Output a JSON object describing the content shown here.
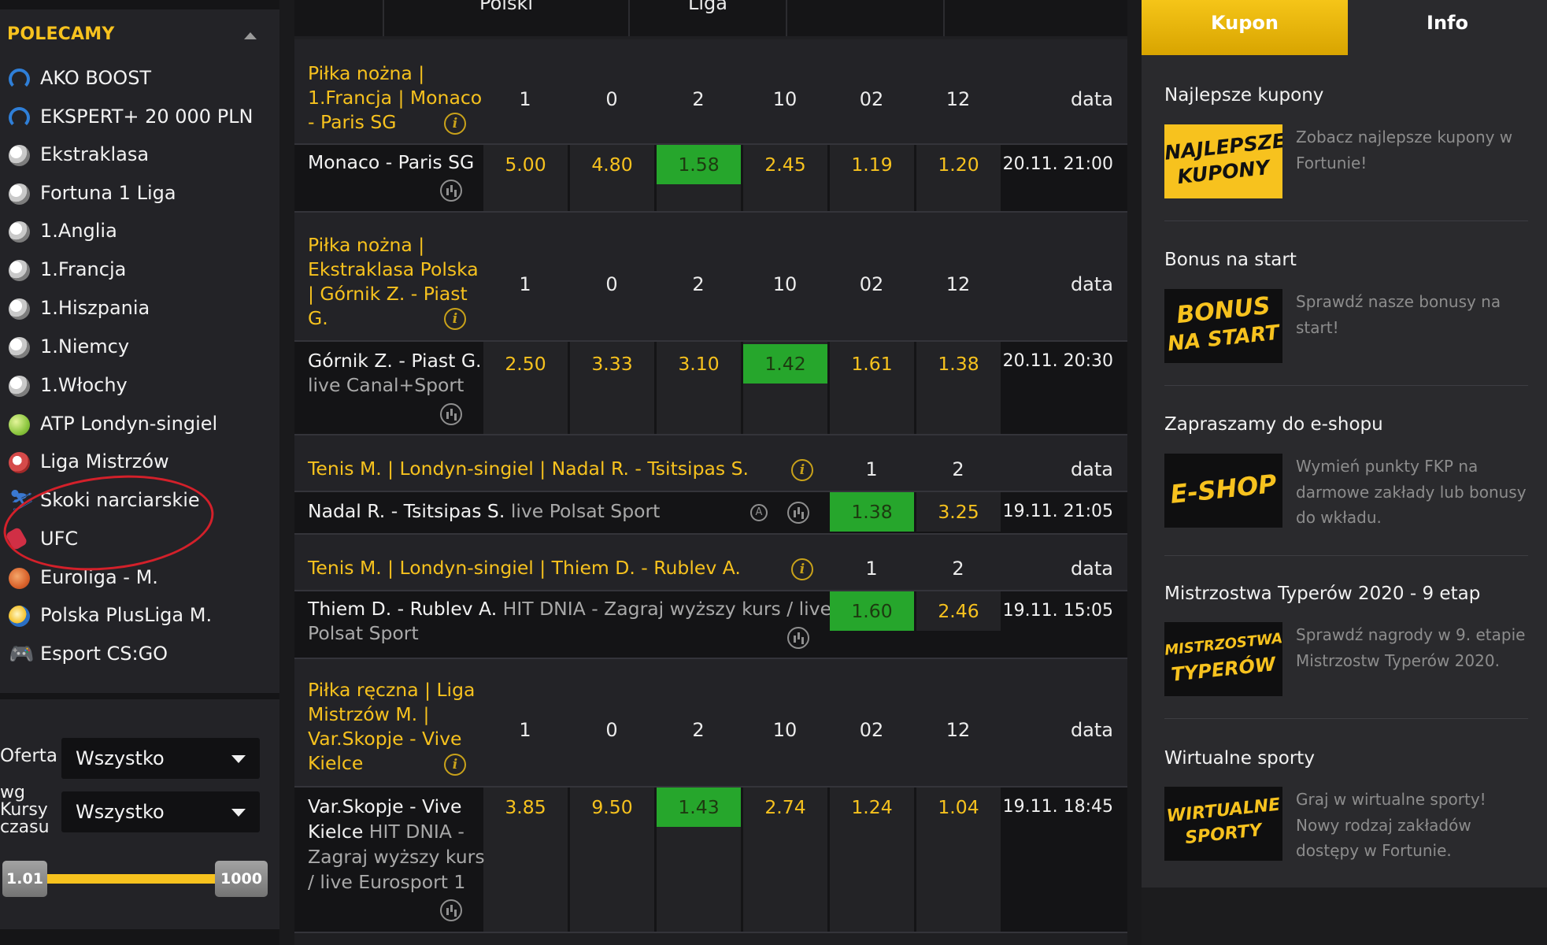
{
  "sidebar": {
    "header": "POLECAMY",
    "items": [
      {
        "label": "AKO BOOST",
        "icon": "headset-icon"
      },
      {
        "label": "EKSPERT+ 20 000 PLN",
        "icon": "headset-icon"
      },
      {
        "label": "Ekstraklasa",
        "icon": "soccer-ball-icon"
      },
      {
        "label": "Fortuna 1 Liga",
        "icon": "soccer-ball-icon"
      },
      {
        "label": "1.Anglia",
        "icon": "soccer-ball-icon"
      },
      {
        "label": "1.Francja",
        "icon": "soccer-ball-icon"
      },
      {
        "label": "1.Hiszpania",
        "icon": "soccer-ball-icon"
      },
      {
        "label": "1.Niemcy",
        "icon": "soccer-ball-icon"
      },
      {
        "label": "1.Włochy",
        "icon": "soccer-ball-icon"
      },
      {
        "label": "ATP Londyn-singiel",
        "icon": "tennis-ball-icon"
      },
      {
        "label": "Liga Mistrzów",
        "icon": "champions-league-ball-icon"
      },
      {
        "label": "Skoki narciarskie",
        "icon": "ski-jumper-icon"
      },
      {
        "label": "UFC",
        "icon": "boxing-glove-icon"
      },
      {
        "label": "Euroliga - M.",
        "icon": "basketball-icon"
      },
      {
        "label": "Polska PlusLiga M.",
        "icon": "volleyball-icon"
      },
      {
        "label": "Esport CS:GO",
        "icon": "gamepad-icon"
      }
    ],
    "filters": {
      "oferta_label": "Oferta",
      "oferta_value": "Wszystko",
      "kursy_label_line1": "wg",
      "kursy_label_line2": "Kursy",
      "kursy_label_line3": "czasu",
      "kursy_value": "Wszystko",
      "odds_min": "1.01",
      "odds_max": "1000"
    }
  },
  "top_header": [
    "",
    "Polski",
    "Liga",
    "",
    ""
  ],
  "events": [
    {
      "league_lines": [
        "Piłka nożna |",
        "1.Francja | Monaco",
        "- Paris SG"
      ],
      "columns": [
        "1",
        "0",
        "2",
        "10",
        "02",
        "12"
      ],
      "date_header": "data",
      "match": "Monaco - Paris SG",
      "extra": "",
      "odds": [
        "5.00",
        "4.80",
        "1.58",
        "2.45",
        "1.19",
        "1.20"
      ],
      "favorite_index": 2,
      "date": "20.11. 21:00"
    },
    {
      "league_lines": [
        "Piłka nożna |",
        "Ekstraklasa Polska",
        "| Górnik Z. - Piast",
        "G."
      ],
      "columns": [
        "1",
        "0",
        "2",
        "10",
        "02",
        "12"
      ],
      "date_header": "data",
      "match": "Górnik Z. - Piast G.",
      "extra": "live Canal+Sport",
      "odds": [
        "2.50",
        "3.33",
        "3.10",
        "1.42",
        "1.61",
        "1.38"
      ],
      "favorite_index": 3,
      "date": "20.11. 20:30"
    },
    {
      "league": "Tenis M. | Londyn-singiel | Nadal R. - Tsitsipas S.",
      "columns": [
        "1",
        "2"
      ],
      "date_header": "data",
      "match": "Nadal R. - Tsitsipas S.",
      "extra": "live Polsat Sport",
      "odds": [
        "1.38",
        "3.25"
      ],
      "favorite_index": 0,
      "date": "19.11. 21:05"
    },
    {
      "league": "Tenis M. | Londyn-singiel | Thiem D. - Rublev A.",
      "columns": [
        "1",
        "2"
      ],
      "date_header": "data",
      "match": "Thiem D. - Rublev A.",
      "extra_line1": "HIT DNIA - Zagraj wyższy kurs / live",
      "extra_line2": "Polsat Sport",
      "odds": [
        "1.60",
        "2.46"
      ],
      "favorite_index": 0,
      "date": "19.11. 15:05"
    },
    {
      "league_lines": [
        "Piłka ręczna | Liga",
        "Mistrzów M. |",
        "Var.Skopje - Vive",
        "Kielce"
      ],
      "columns": [
        "1",
        "0",
        "2",
        "10",
        "02",
        "12"
      ],
      "date_header": "data",
      "match_line1": "Var.Skopje - Vive",
      "match_line2": "Kielce",
      "extra_line2": "HIT DNIA -",
      "extra_line3": "Zagraj wyższy kurs",
      "extra_line4": "/ live Eurosport 1",
      "odds": [
        "3.85",
        "9.50",
        "1.43",
        "2.74",
        "1.24",
        "1.04"
      ],
      "favorite_index": 2,
      "date": "19.11. 18:45"
    }
  ],
  "right_panel": {
    "tabs": {
      "kupon": "Kupon",
      "info": "Info"
    },
    "promos": [
      {
        "title": "Najlepsze kupony",
        "image_line1": "NAJLEPSZE",
        "image_line2": "KUPONY",
        "desc": "Zobacz najlepsze kupony w Fortunie!",
        "image_bg": "#f7c21e",
        "image_fg": "#111111"
      },
      {
        "title": "Bonus na start",
        "image_line1": "BONUS",
        "image_line2": "NA START",
        "desc": "Sprawdź nasze bonusy na start!",
        "image_bg": "#0f0f10",
        "image_fg": "#f7c21e"
      },
      {
        "title": "Zapraszamy do e-shopu",
        "image_line1": "E-SHOP",
        "image_line2": "",
        "desc": "Wymień punkty FKP na darmowe zakłady lub bonusy do wkładu.",
        "image_bg": "#0f0f10",
        "image_fg": "#f7c21e"
      },
      {
        "title": "Mistrzostwa Typerów 2020 - 9 etap",
        "image_line1": "MISTRZOSTWA",
        "image_line2": "TYPERÓW",
        "desc": "Sprawdź nagrody w 9. etapie Mistrzostw Typerów 2020.",
        "image_bg": "#0f0f10",
        "image_fg": "#f7c21e"
      },
      {
        "title": "Wirtualne sporty",
        "image_line1": "WIRTUALNE",
        "image_line2": "SPORTY",
        "desc": "Graj w wirtualne sporty! Nowy rodzaj zakładów dostępy w Fortunie.",
        "image_bg": "#0f0f10",
        "image_fg": "#f7c21e"
      }
    ]
  },
  "colors": {
    "accent": "#f7c21e",
    "favorite": "#26a62c",
    "annotation": "#d3202a"
  }
}
